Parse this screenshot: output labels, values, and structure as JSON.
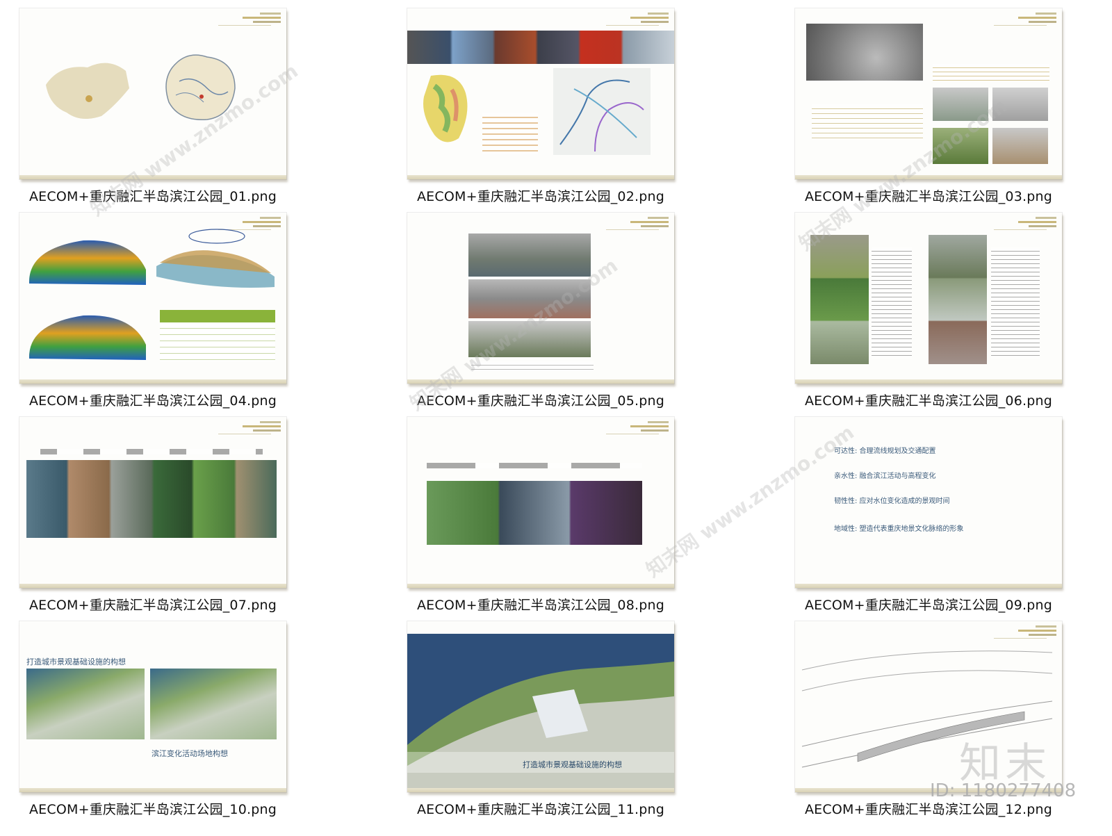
{
  "files": [
    {
      "name": "AECOM+重庆融汇半岛滨江公园_01.png"
    },
    {
      "name": "AECOM+重庆融汇半岛滨江公园_02.png"
    },
    {
      "name": "AECOM+重庆融汇半岛滨江公园_03.png"
    },
    {
      "name": "AECOM+重庆融汇半岛滨江公园_04.png"
    },
    {
      "name": "AECOM+重庆融汇半岛滨江公园_05.png"
    },
    {
      "name": "AECOM+重庆融汇半岛滨江公园_06.png"
    },
    {
      "name": "AECOM+重庆融汇半岛滨江公园_07.png"
    },
    {
      "name": "AECOM+重庆融汇半岛滨江公园_08.png"
    },
    {
      "name": "AECOM+重庆融汇半岛滨江公园_09.png"
    },
    {
      "name": "AECOM+重庆融汇半岛滨江公园_10.png"
    },
    {
      "name": "AECOM+重庆融汇半岛滨江公园_11.png"
    },
    {
      "name": "AECOM+重庆融汇半岛滨江公园_12.png"
    }
  ],
  "slide09": {
    "line1": "可达性: 合理流线规划及交通配置",
    "line2": "亲水性: 融合滨江活动与高程变化",
    "line3": "韧性性: 应对水位变化造成的景观时间",
    "line4": "地域性: 塑造代表重庆地景文化脉络的形象"
  },
  "slide10": {
    "title": "打造城市景观基础设施的构想",
    "subtitle": "滨江变化活动场地构想"
  },
  "slide11": {
    "caption": "打造城市景观基础设施的构想"
  },
  "watermark": {
    "text": "知末网 www.znzmo.com",
    "logo": "知末",
    "id": "ID: 1180277408"
  }
}
